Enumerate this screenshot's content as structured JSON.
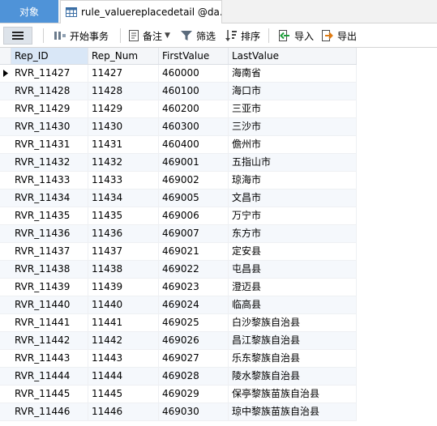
{
  "tabs": {
    "objects_label": "对象",
    "table_tab_label": "rule_valuereplacedetail @da..."
  },
  "toolbar": {
    "begin_transaction": "开始事务",
    "note": "备注",
    "filter": "筛选",
    "sort": "排序",
    "import": "导入",
    "export": "导出"
  },
  "columns": [
    "Rep_ID",
    "Rep_Num",
    "FirstValue",
    "LastValue"
  ],
  "rows": [
    [
      "RVR_11427",
      "11427",
      "460000",
      "海南省"
    ],
    [
      "RVR_11428",
      "11428",
      "460100",
      "海口市"
    ],
    [
      "RVR_11429",
      "11429",
      "460200",
      "三亚市"
    ],
    [
      "RVR_11430",
      "11430",
      "460300",
      "三沙市"
    ],
    [
      "RVR_11431",
      "11431",
      "460400",
      "儋州市"
    ],
    [
      "RVR_11432",
      "11432",
      "469001",
      "五指山市"
    ],
    [
      "RVR_11433",
      "11433",
      "469002",
      "琼海市"
    ],
    [
      "RVR_11434",
      "11434",
      "469005",
      "文昌市"
    ],
    [
      "RVR_11435",
      "11435",
      "469006",
      "万宁市"
    ],
    [
      "RVR_11436",
      "11436",
      "469007",
      "东方市"
    ],
    [
      "RVR_11437",
      "11437",
      "469021",
      "定安县"
    ],
    [
      "RVR_11438",
      "11438",
      "469022",
      "屯昌县"
    ],
    [
      "RVR_11439",
      "11439",
      "469023",
      "澄迈县"
    ],
    [
      "RVR_11440",
      "11440",
      "469024",
      "临高县"
    ],
    [
      "RVR_11441",
      "11441",
      "469025",
      "白沙黎族自治县"
    ],
    [
      "RVR_11442",
      "11442",
      "469026",
      "昌江黎族自治县"
    ],
    [
      "RVR_11443",
      "11443",
      "469027",
      "乐东黎族自治县"
    ],
    [
      "RVR_11444",
      "11444",
      "469028",
      "陵水黎族自治县"
    ],
    [
      "RVR_11445",
      "11445",
      "469029",
      "保亭黎族苗族自治县"
    ],
    [
      "RVR_11446",
      "11446",
      "469030",
      "琼中黎族苗族自治县"
    ]
  ],
  "current_row": 0,
  "colors": {
    "accent": "#4f93d8",
    "alt_row": "#f5f8fc",
    "header_bg": "#f4f6f9"
  }
}
